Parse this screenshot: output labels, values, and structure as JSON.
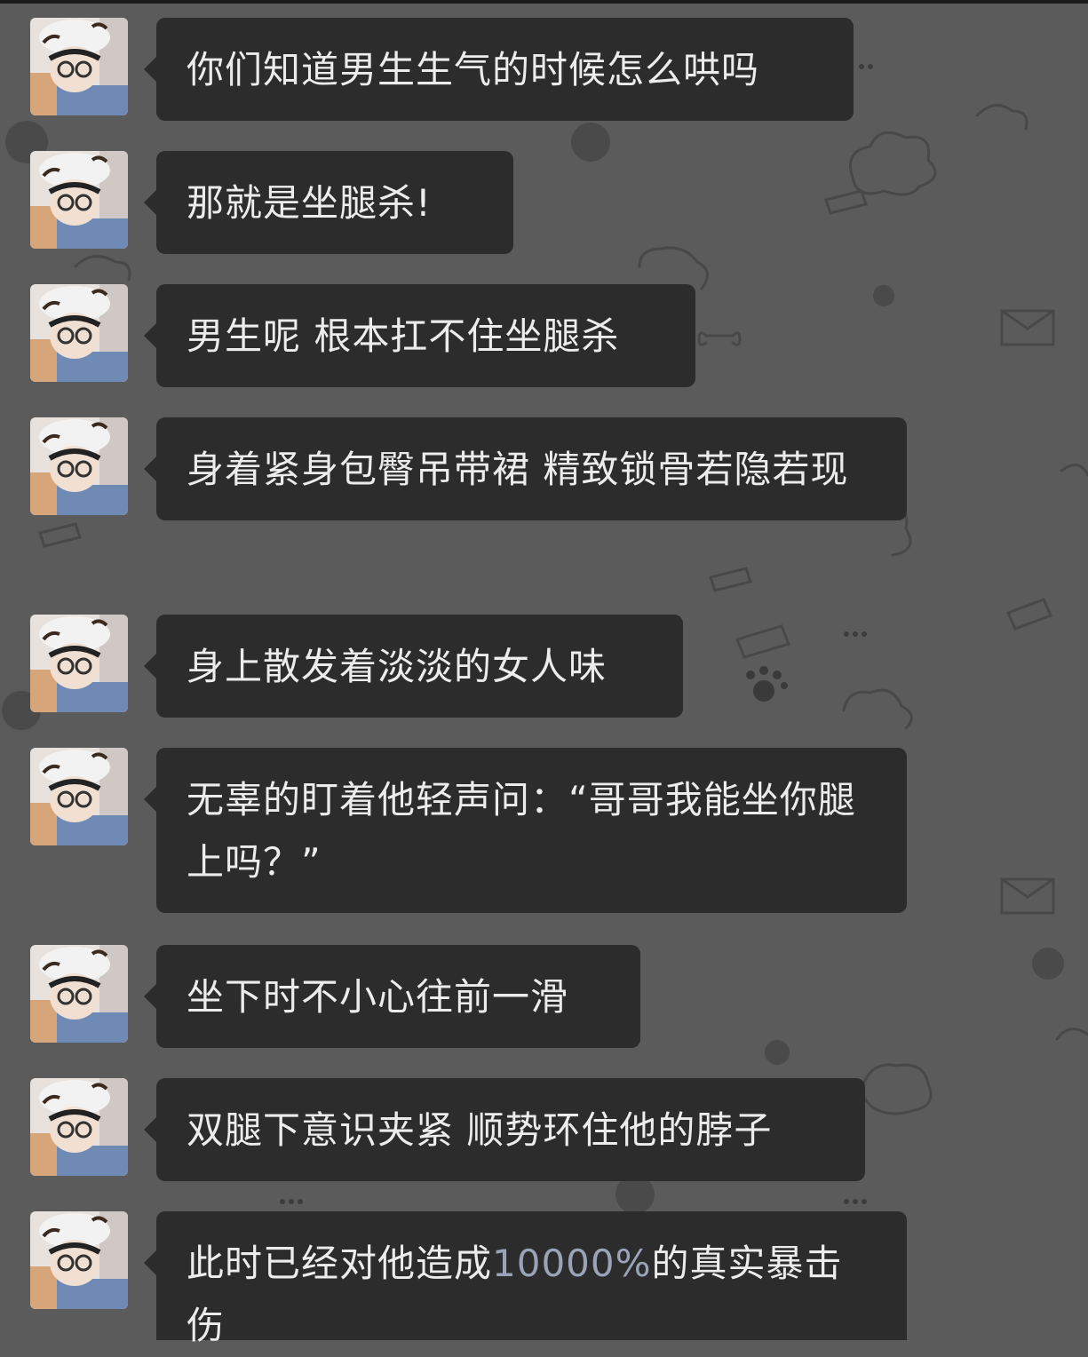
{
  "chat": {
    "messages": [
      {
        "text": "你们知道男生生气的时候怎么哄吗"
      },
      {
        "text": "那就是坐腿杀!"
      },
      {
        "text": "男生呢 根本扛不住坐腿杀"
      },
      {
        "text": "身着紧身包臀吊带裙 精致锁骨若隐若现"
      },
      {
        "text": "身上散发着淡淡的女人味"
      },
      {
        "text": "无辜的盯着他轻声问：“哥哥我能坐你腿上吗？”"
      },
      {
        "text": "坐下时不小心往前一滑"
      },
      {
        "text": "双腿下意识夹紧 顺势环住他的脖子"
      },
      {
        "text_before": "此时已经对他造成",
        "highlight": "10000%",
        "text_after": "的真实暴击伤"
      }
    ]
  },
  "colors": {
    "background": "#5b5b5b",
    "bubble": "#2c2c2c",
    "text": "#ececec",
    "highlight": "#9aa3b8"
  }
}
